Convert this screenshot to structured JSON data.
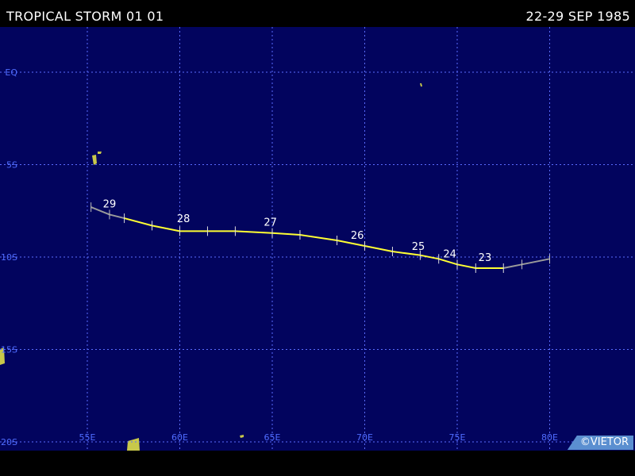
{
  "header": {
    "title": "TROPICAL STORM 01 01",
    "date_range": "22-29 SEP 1985"
  },
  "credit": "©VIETOR",
  "colors": {
    "ocean": "#02045e",
    "grid": "#5a6cff",
    "track_storm": "#ffff33",
    "track_weak": "#9a9a9a",
    "land": "#c8c84a"
  },
  "map": {
    "lon_range": [
      52.5,
      77.5
    ],
    "lat_range": [
      -20,
      2.5
    ],
    "longitudes": [
      55,
      60,
      65,
      70,
      75,
      80
    ],
    "lon_labels": [
      "55E",
      "60E",
      "65E",
      "70E",
      "75E",
      "80E"
    ],
    "latitudes": [
      0,
      -5,
      -10,
      -15,
      -20
    ],
    "lat_labels": [
      "EQ",
      "5S",
      "10S",
      "15S",
      "20S"
    ]
  },
  "track": {
    "points": [
      {
        "lon": 80.0,
        "lat": -10.1,
        "stage": "weak"
      },
      {
        "lon": 78.5,
        "lat": -10.4,
        "stage": "weak"
      },
      {
        "lon": 77.5,
        "lat": -10.6,
        "stage": "storm"
      },
      {
        "lon": 76.0,
        "lat": -10.6,
        "stage": "storm"
      },
      {
        "lon": 75.0,
        "lat": -10.4,
        "stage": "storm"
      },
      {
        "lon": 74.0,
        "lat": -10.1,
        "stage": "storm"
      },
      {
        "lon": 73.0,
        "lat": -9.9,
        "stage": "storm"
      },
      {
        "lon": 71.5,
        "lat": -9.7,
        "stage": "storm"
      },
      {
        "lon": 70.0,
        "lat": -9.4,
        "stage": "storm"
      },
      {
        "lon": 68.5,
        "lat": -9.1,
        "stage": "storm"
      },
      {
        "lon": 66.5,
        "lat": -8.8,
        "stage": "storm"
      },
      {
        "lon": 65.0,
        "lat": -8.7,
        "stage": "storm"
      },
      {
        "lon": 63.0,
        "lat": -8.6,
        "stage": "storm"
      },
      {
        "lon": 61.5,
        "lat": -8.6,
        "stage": "storm"
      },
      {
        "lon": 60.0,
        "lat": -8.6,
        "stage": "storm"
      },
      {
        "lon": 58.5,
        "lat": -8.3,
        "stage": "storm"
      },
      {
        "lon": 57.0,
        "lat": -7.9,
        "stage": "storm"
      },
      {
        "lon": 56.2,
        "lat": -7.7,
        "stage": "weak"
      },
      {
        "lon": 55.2,
        "lat": -7.3,
        "stage": "weak"
      }
    ],
    "day_labels": [
      {
        "text": "23",
        "lon": 76.5,
        "lat": -10.3
      },
      {
        "text": "24",
        "lon": 74.6,
        "lat": -10.1
      },
      {
        "text": "25",
        "lon": 72.9,
        "lat": -9.7
      },
      {
        "text": "26",
        "lon": 69.6,
        "lat": -9.1
      },
      {
        "text": "27",
        "lon": 64.9,
        "lat": -8.4
      },
      {
        "text": "28",
        "lon": 60.2,
        "lat": -8.2
      },
      {
        "text": "29",
        "lon": 56.2,
        "lat": -7.4
      }
    ]
  }
}
